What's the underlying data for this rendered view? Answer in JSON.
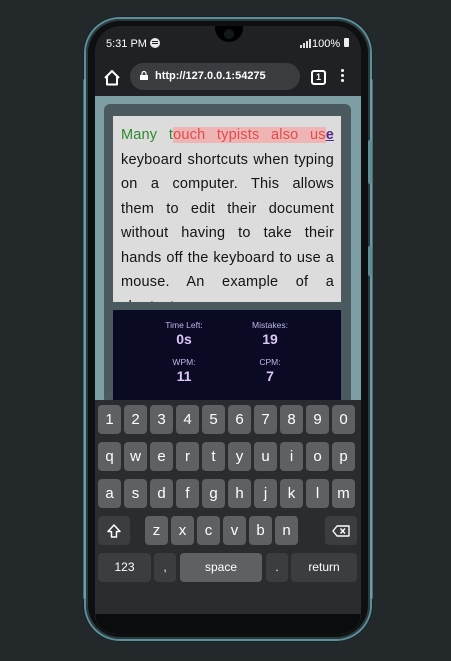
{
  "status": {
    "time": "5:31 PM",
    "battery": "100%"
  },
  "browser": {
    "url": "http://127.0.0.1:54275",
    "tab_count": "1"
  },
  "passage": {
    "typed": "Many t",
    "wrong": "ouch typists also us",
    "current": "e",
    "remaining": " keyboard shortcuts when typing on a computer. This allows them to edit their document without having to take their hands off the keyboard to use a mouse. An example of a shortcut"
  },
  "stats": {
    "time_left_label": "Time Left:",
    "time_left_value": "0s",
    "mistakes_label": "Mistakes:",
    "mistakes_value": "19",
    "wpm_label": "WPM:",
    "wpm_value": "11",
    "cpm_label": "CPM:",
    "cpm_value": "7"
  },
  "keyboard": {
    "row_numbers": [
      "1",
      "2",
      "3",
      "4",
      "5",
      "6",
      "7",
      "8",
      "9",
      "0"
    ],
    "row_top": [
      "q",
      "w",
      "e",
      "r",
      "t",
      "y",
      "u",
      "i",
      "o",
      "p"
    ],
    "row_middle": [
      "a",
      "s",
      "d",
      "f",
      "g",
      "h",
      "j",
      "k",
      "l",
      "m"
    ],
    "row_bottom": [
      "z",
      "x",
      "c",
      "v",
      "b",
      "n"
    ],
    "symbols_key": "123",
    "comma_key": ",",
    "space_key": "space",
    "period_key": ".",
    "return_key": "return"
  },
  "colors": {
    "typed": "#2e8b2e",
    "error": "#e24b4b",
    "current": "#5a2a8a",
    "stats_bg": "#0a0a24"
  }
}
